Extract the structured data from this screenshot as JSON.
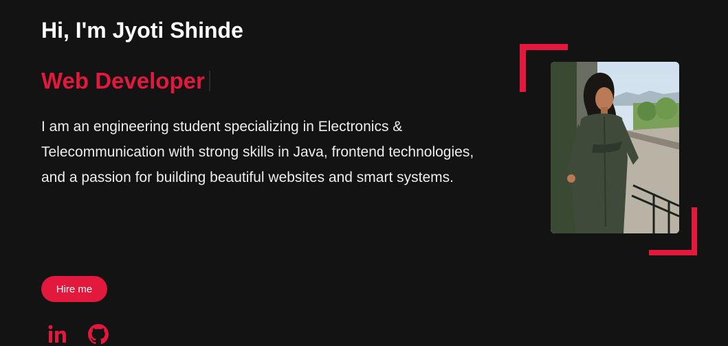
{
  "hero": {
    "greeting": "Hi, I'm Jyoti Shinde",
    "role": "Web Developer",
    "bio": "I am an engineering student specializing in Electronics & Telecommunication with strong skills in Java, frontend technologies, and a passion for building beautiful websites and smart systems.",
    "hire_label": "Hire me"
  },
  "socials": [
    {
      "icon": "linkedin-icon"
    },
    {
      "icon": "github-icon"
    }
  ],
  "colors": {
    "background": "#141314",
    "accent": "#e3183d",
    "text": "#ffffff"
  }
}
